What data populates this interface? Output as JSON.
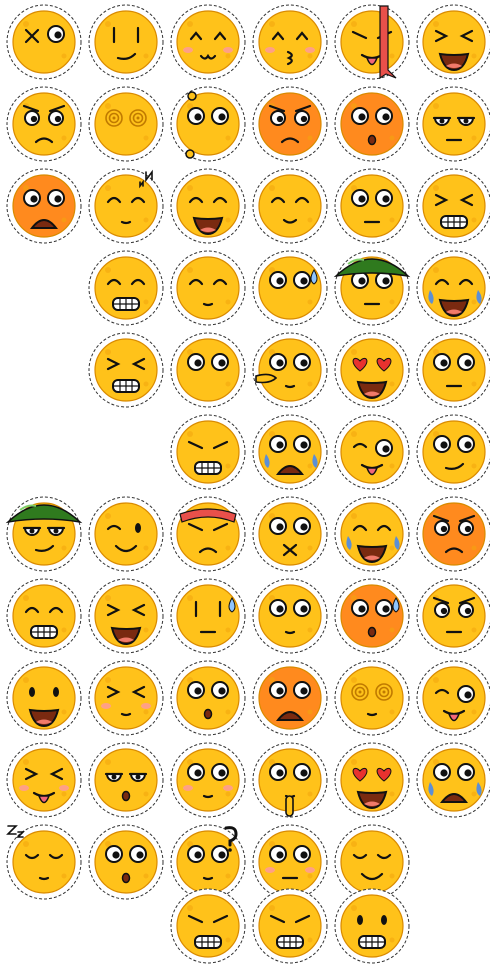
{
  "sheet": {
    "background": "#ffffff",
    "colors": {
      "face": "#ffc21a",
      "face_alt": "#ff8a1e",
      "outline": "#111111",
      "sticker_border": "#ffffff",
      "cheek": "#ff9a9a",
      "tear": "#5b8fd6"
    },
    "rows": [
      {
        "count": 6,
        "emojis": [
          {
            "name": "x-eye-wink",
            "face": "yellow",
            "eyes": "x-round",
            "mouth": "none"
          },
          {
            "name": "side-eye-smirk",
            "face": "yellow",
            "eyes": "lines",
            "mouth": "smirk"
          },
          {
            "name": "blushing-cute",
            "face": "yellow",
            "eyes": "caret",
            "mouth": "cat",
            "blush": true
          },
          {
            "name": "kissy-blush",
            "face": "yellow",
            "eyes": "caret",
            "mouth": "kiss",
            "blush": true
          },
          {
            "name": "tongue-out-ribbon",
            "face": "yellow",
            "eyes": "slant",
            "mouth": "tongue",
            "accessory": "red-ribbon"
          },
          {
            "name": "grin-squint",
            "face": "yellow",
            "eyes": "squint",
            "mouth": "grin"
          }
        ]
      },
      {
        "count": 6,
        "emojis": [
          {
            "name": "angry-frown",
            "face": "yellow",
            "eyes": "angry-round",
            "mouth": "frown"
          },
          {
            "name": "dizzy-swirl",
            "face": "yellow",
            "eyes": "swirl",
            "mouth": "none"
          },
          {
            "name": "startled-dots",
            "face": "yellow",
            "eyes": "round-big",
            "mouth": "none",
            "accessory": "dots"
          },
          {
            "name": "furious-orange",
            "face": "orange",
            "eyes": "angry-round",
            "mouth": "frown"
          },
          {
            "name": "shocked-orange",
            "face": "orange",
            "eyes": "round-big",
            "mouth": "small-o"
          },
          {
            "name": "annoyed-flat",
            "face": "yellow",
            "eyes": "half",
            "mouth": "flat"
          }
        ]
      },
      {
        "count": 6,
        "emojis": [
          {
            "name": "crying-orange-tilted",
            "face": "orange",
            "eyes": "round-big",
            "mouth": "wail"
          },
          {
            "name": "sleepy-n",
            "face": "yellow",
            "eyes": "arcs",
            "mouth": "small",
            "accessory": "letters-n"
          },
          {
            "name": "big-laugh",
            "face": "yellow",
            "eyes": "arcs",
            "mouth": "grin-side"
          },
          {
            "name": "calm-smile",
            "face": "yellow",
            "eyes": "arcs",
            "mouth": "smile-small"
          },
          {
            "name": "wide-eyes",
            "face": "yellow",
            "eyes": "round-big",
            "mouth": "flat"
          },
          {
            "name": "teeth-grin-squint",
            "face": "yellow",
            "eyes": "squint",
            "mouth": "teeth"
          }
        ]
      },
      {
        "count": 5,
        "emojis": [
          {
            "name": "teeth-side",
            "face": "yellow",
            "eyes": "arcs",
            "mouth": "teeth"
          },
          {
            "name": "side-glance",
            "face": "yellow",
            "eyes": "arcs",
            "mouth": "small"
          },
          {
            "name": "sweat-side",
            "face": "yellow",
            "eyes": "round-big",
            "mouth": "none",
            "accessory": "sweat"
          },
          {
            "name": "green-helmet",
            "face": "yellow",
            "eyes": "round-big",
            "mouth": "flat",
            "accessory": "green-helmet"
          },
          {
            "name": "laugh-tears",
            "face": "yellow",
            "eyes": "arcs",
            "mouth": "grin",
            "tears": true
          }
        ]
      },
      {
        "count": 5,
        "emojis": [
          {
            "name": "grimace-cry",
            "face": "yellow",
            "eyes": "squint",
            "mouth": "teeth"
          },
          {
            "name": "dazed-look",
            "face": "yellow",
            "eyes": "round-big",
            "mouth": "none"
          },
          {
            "name": "pointing-hand",
            "face": "yellow",
            "eyes": "round-big",
            "mouth": "small",
            "accessory": "hand"
          },
          {
            "name": "heart-eyes-side",
            "face": "yellow",
            "eyes": "heart",
            "mouth": "grin-side"
          },
          {
            "name": "skeptical",
            "face": "yellow",
            "eyes": "round-big",
            "mouth": "flat"
          }
        ]
      },
      {
        "count": 4,
        "emojis": [
          {
            "name": "gritted-teeth",
            "face": "yellow",
            "eyes": "slant",
            "mouth": "teeth"
          },
          {
            "name": "sobbing-blue",
            "face": "yellow",
            "eyes": "round-big",
            "mouth": "wail",
            "tears": true
          },
          {
            "name": "silly-tongue",
            "face": "yellow",
            "eyes": "mixed",
            "mouth": "tongue"
          },
          {
            "name": "peeking-side",
            "face": "yellow",
            "eyes": "round-big",
            "mouth": "smirk"
          }
        ]
      },
      {
        "count": 6,
        "emojis": [
          {
            "name": "soldier-smoke",
            "face": "yellow",
            "eyes": "half",
            "mouth": "smirk",
            "accessory": "green-helmet"
          },
          {
            "name": "wink-smile",
            "face": "yellow",
            "eyes": "wink",
            "mouth": "smile"
          },
          {
            "name": "headband-frown",
            "face": "yellow",
            "eyes": "slant",
            "mouth": "frown",
            "accessory": "red-headband"
          },
          {
            "name": "mouth-x",
            "face": "yellow",
            "eyes": "round-big",
            "mouth": "x"
          },
          {
            "name": "joy-tears",
            "face": "yellow",
            "eyes": "arcs",
            "mouth": "grin",
            "tears": true
          },
          {
            "name": "mad-orange",
            "face": "orange",
            "eyes": "angry-round",
            "mouth": "frown"
          }
        ]
      },
      {
        "count": 6,
        "emojis": [
          {
            "name": "big-grin-teeth",
            "face": "yellow",
            "eyes": "arcs",
            "mouth": "teeth"
          },
          {
            "name": "squint-laugh",
            "face": "yellow",
            "eyes": "squint",
            "mouth": "grin"
          },
          {
            "name": "meh-sweat",
            "face": "yellow",
            "eyes": "lines",
            "mouth": "flat",
            "accessory": "sweat"
          },
          {
            "name": "worried-look-up",
            "face": "yellow",
            "eyes": "round-big",
            "mouth": "small"
          },
          {
            "name": "nervous-orange",
            "face": "orange",
            "eyes": "round-big",
            "mouth": "small-o",
            "accessory": "sweat"
          },
          {
            "name": "disappointed",
            "face": "yellow",
            "eyes": "angry-round",
            "mouth": "flat"
          }
        ]
      },
      {
        "count": 6,
        "emojis": [
          {
            "name": "happy-open",
            "face": "yellow",
            "eyes": "dots",
            "mouth": "grin"
          },
          {
            "name": "scrunched-blush",
            "face": "yellow",
            "eyes": "squint",
            "mouth": "small",
            "blush": true
          },
          {
            "name": "surprised-brows",
            "face": "yellow",
            "eyes": "round-big",
            "mouth": "small-o"
          },
          {
            "name": "upset-orange",
            "face": "orange",
            "eyes": "round-big",
            "mouth": "wail"
          },
          {
            "name": "dizzy-swirl-2",
            "face": "yellow",
            "eyes": "swirl",
            "mouth": "small"
          },
          {
            "name": "tongue-wink",
            "face": "yellow",
            "eyes": "mixed",
            "mouth": "tongue"
          }
        ]
      },
      {
        "count": 6,
        "emojis": [
          {
            "name": "smug-blush",
            "face": "yellow",
            "eyes": "squint",
            "mouth": "tongue",
            "blush": true
          },
          {
            "name": "bored-eyes",
            "face": "yellow",
            "eyes": "half",
            "mouth": "small-o"
          },
          {
            "name": "big-eyes-blush",
            "face": "yellow",
            "eyes": "round-big",
            "mouth": "small",
            "blush": true
          },
          {
            "name": "shushing-finger",
            "face": "yellow",
            "eyes": "round-big",
            "mouth": "small",
            "accessory": "finger"
          },
          {
            "name": "heart-eyes-drool",
            "face": "yellow",
            "eyes": "heart",
            "mouth": "grin"
          },
          {
            "name": "crying-side",
            "face": "yellow",
            "eyes": "round-big",
            "mouth": "wail",
            "tears": true
          }
        ]
      },
      {
        "count": 5,
        "emojis": [
          {
            "name": "sleeping-z",
            "face": "yellow",
            "eyes": "arcs-down",
            "mouth": "small",
            "accessory": "letters-z"
          },
          {
            "name": "shocked-tilt",
            "face": "yellow",
            "eyes": "round-big",
            "mouth": "small-o"
          },
          {
            "name": "confused-question",
            "face": "yellow",
            "eyes": "round-big",
            "mouth": "small",
            "accessory": "question"
          },
          {
            "name": "stunned-blush",
            "face": "yellow",
            "eyes": "round-big",
            "mouth": "flat",
            "blush": true
          },
          {
            "name": "content-smile",
            "face": "yellow",
            "eyes": "arcs-down",
            "mouth": "smile"
          }
        ]
      },
      {
        "count": 3,
        "emojis": [
          {
            "name": "angry-teeth",
            "face": "yellow",
            "eyes": "slant",
            "mouth": "teeth"
          },
          {
            "name": "sneaky-grin",
            "face": "yellow",
            "eyes": "slant",
            "mouth": "teeth"
          },
          {
            "name": "bared-teeth",
            "face": "yellow",
            "eyes": "dots",
            "mouth": "teeth"
          }
        ]
      }
    ]
  }
}
